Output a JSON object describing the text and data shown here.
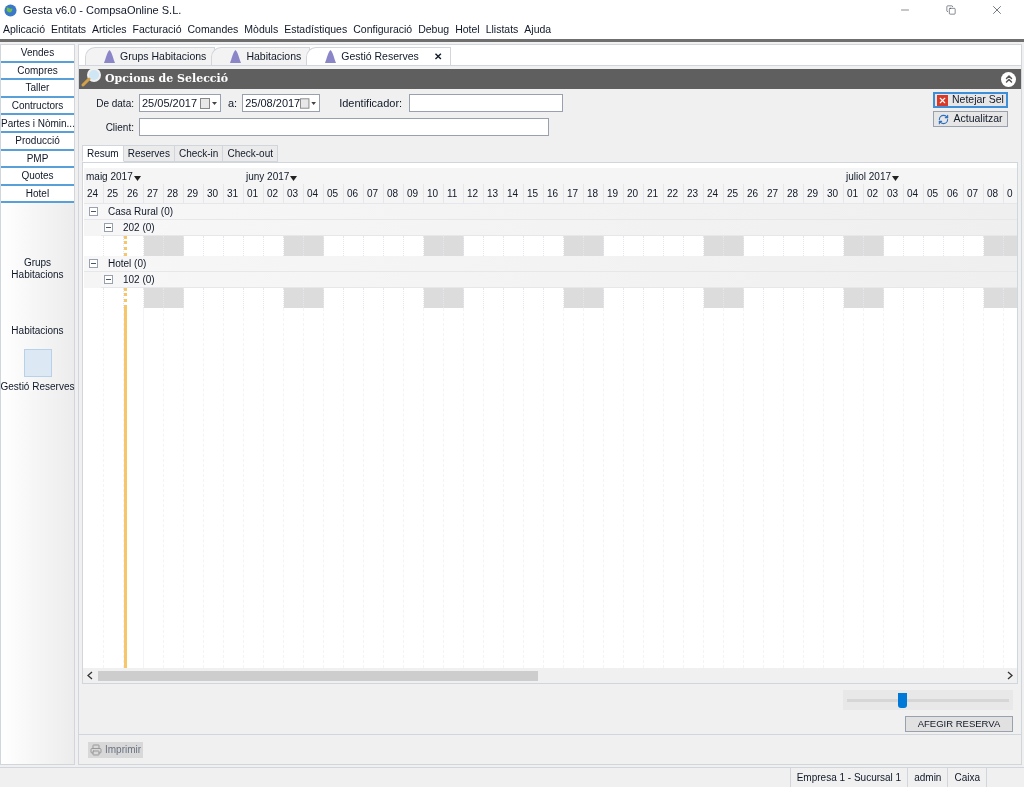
{
  "window": {
    "title": "Gesta v6.0 - CompsaOnline S.L."
  },
  "menu": [
    "Aplicació",
    "Entitats",
    "Articles",
    "Facturació",
    "Comandes",
    "Mòduls",
    "Estadístiques",
    "Configuració",
    "Debug",
    "Hotel",
    "Llistats",
    "Ajuda"
  ],
  "sidebar": {
    "sections": [
      "Vendes",
      "Compres",
      "Taller",
      "Contructors",
      "Partes i Nòmin...",
      "Producció",
      "PMP",
      "Quotes",
      "Hotel"
    ],
    "modules": [
      {
        "label": "Grups Habitacions",
        "selected": false
      },
      {
        "label": "Habitacions",
        "selected": false
      },
      {
        "label": "Gestió Reserves",
        "selected": true
      }
    ]
  },
  "doc_tabs": [
    {
      "label": "Grups Habitacions",
      "selected": false
    },
    {
      "label": "Habitacions",
      "selected": false
    },
    {
      "label": "Gestió Reserves",
      "selected": true,
      "close": "✕"
    }
  ],
  "panel": {
    "title": "Opcions de Selecció"
  },
  "filters": {
    "from_label": "De data:",
    "from": "25/05/2017",
    "to_label": "a:",
    "to": "25/08/2017",
    "id_label": "Identificador:",
    "client_label": "Client:"
  },
  "buttons": [
    {
      "label": "Netejar Sel",
      "kind": "clear",
      "focused": true
    },
    {
      "label": "Actualitzar",
      "kind": "refresh",
      "focused": false
    }
  ],
  "sub_tabs": [
    {
      "label": "Resum",
      "selected": true
    },
    {
      "label": "Reserves",
      "selected": false
    },
    {
      "label": "Check-in",
      "selected": false
    },
    {
      "label": "Check-out",
      "selected": false
    }
  ],
  "days": [
    {
      "label": "24",
      "month": "maig 2017",
      "weekend": false,
      "today": false
    },
    {
      "label": "25",
      "weekend": false,
      "today": false
    },
    {
      "label": "26",
      "weekend": false,
      "today": true
    },
    {
      "label": "27",
      "weekend": true,
      "today": false
    },
    {
      "label": "28",
      "weekend": true,
      "today": false
    },
    {
      "label": "29",
      "weekend": false,
      "today": false
    },
    {
      "label": "30",
      "weekend": false,
      "today": false
    },
    {
      "label": "31",
      "weekend": false,
      "today": false
    },
    {
      "label": "01",
      "month": "juny 2017",
      "weekend": false,
      "today": false
    },
    {
      "label": "02",
      "weekend": false,
      "today": false
    },
    {
      "label": "03",
      "weekend": true,
      "today": false
    },
    {
      "label": "04",
      "weekend": true,
      "today": false
    },
    {
      "label": "05",
      "weekend": false,
      "today": false
    },
    {
      "label": "06",
      "weekend": false,
      "today": false
    },
    {
      "label": "07",
      "weekend": false,
      "today": false
    },
    {
      "label": "08",
      "weekend": false,
      "today": false
    },
    {
      "label": "09",
      "weekend": false,
      "today": false
    },
    {
      "label": "10",
      "weekend": true,
      "today": false
    },
    {
      "label": "11",
      "weekend": true,
      "today": false
    },
    {
      "label": "12",
      "weekend": false,
      "today": false
    },
    {
      "label": "13",
      "weekend": false,
      "today": false
    },
    {
      "label": "14",
      "weekend": false,
      "today": false
    },
    {
      "label": "15",
      "weekend": false,
      "today": false
    },
    {
      "label": "16",
      "weekend": false,
      "today": false
    },
    {
      "label": "17",
      "weekend": true,
      "today": false
    },
    {
      "label": "18",
      "weekend": true,
      "today": false
    },
    {
      "label": "19",
      "weekend": false,
      "today": false
    },
    {
      "label": "20",
      "weekend": false,
      "today": false
    },
    {
      "label": "21",
      "weekend": false,
      "today": false
    },
    {
      "label": "22",
      "weekend": false,
      "today": false
    },
    {
      "label": "23",
      "weekend": false,
      "today": false
    },
    {
      "label": "24",
      "weekend": true,
      "today": false
    },
    {
      "label": "25",
      "weekend": true,
      "today": false
    },
    {
      "label": "26",
      "weekend": false,
      "today": false
    },
    {
      "label": "27",
      "weekend": false,
      "today": false
    },
    {
      "label": "28",
      "weekend": false,
      "today": false
    },
    {
      "label": "29",
      "weekend": false,
      "today": false
    },
    {
      "label": "30",
      "weekend": false,
      "today": false
    },
    {
      "label": "01",
      "month": "juliol 2017",
      "weekend": true,
      "today": false
    },
    {
      "label": "02",
      "weekend": true,
      "today": false
    },
    {
      "label": "03",
      "weekend": false,
      "today": false
    },
    {
      "label": "04",
      "weekend": false,
      "today": false
    },
    {
      "label": "05",
      "weekend": false,
      "today": false
    },
    {
      "label": "06",
      "weekend": false,
      "today": false
    },
    {
      "label": "07",
      "weekend": false,
      "today": false
    },
    {
      "label": "08",
      "weekend": true,
      "today": false
    },
    {
      "label": "0",
      "weekend": true,
      "today": false
    }
  ],
  "groups": [
    {
      "label": "Casa Rural (0)",
      "expanded": true,
      "children": [
        {
          "label": "202 (0)",
          "expanded": true
        }
      ]
    },
    {
      "label": "Hotel (0)",
      "expanded": true,
      "children": [
        {
          "label": "102 (0)",
          "expanded": true
        }
      ]
    }
  ],
  "zoom_slider": {
    "level": 0.34
  },
  "add_button": "AFEGIR RESERVA",
  "print_button": {
    "label": "Imprimir",
    "disabled": true
  },
  "status_bar": [
    "Empresa 1 - Sucursal 1",
    "admin",
    "Caixa"
  ]
}
